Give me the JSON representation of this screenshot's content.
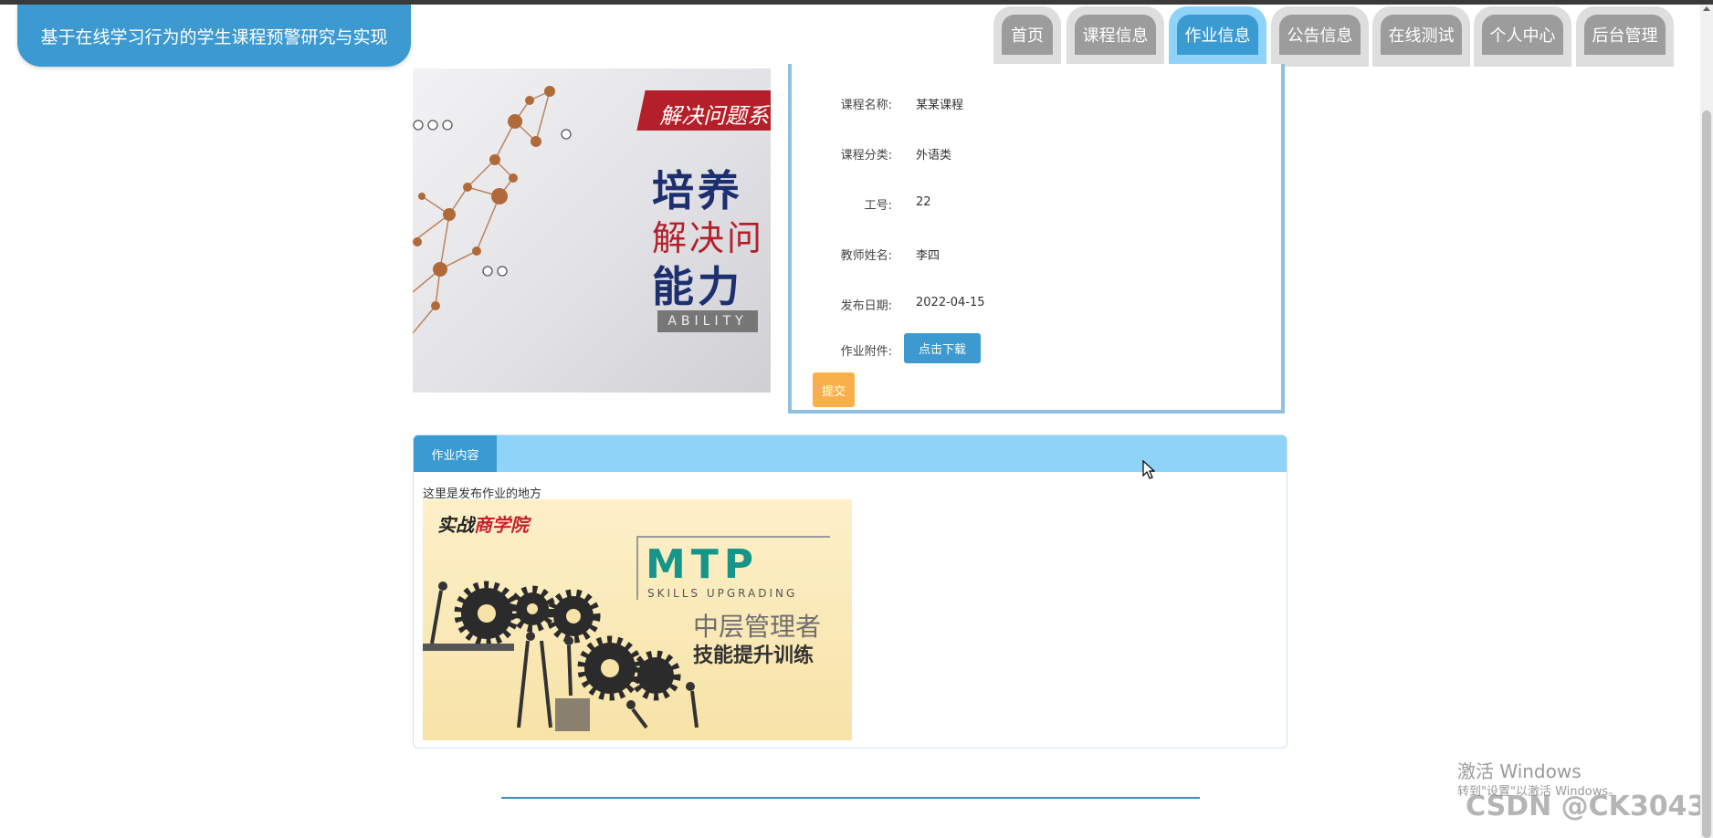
{
  "site": {
    "title": "基于在线学习行为的学生课程预警研究与实现"
  },
  "nav": {
    "items": [
      {
        "label": "首页",
        "active": false
      },
      {
        "label": "课程信息",
        "active": false
      },
      {
        "label": "作业信息",
        "active": true
      },
      {
        "label": "公告信息",
        "active": false
      },
      {
        "label": "在线测试",
        "active": false
      },
      {
        "label": "个人中心",
        "active": false
      },
      {
        "label": "后台管理",
        "active": false
      }
    ]
  },
  "banner": {
    "band_text": "解决问题系",
    "line1": "培养",
    "line2": "解决问",
    "line3": "能力",
    "tag": "ABILITY"
  },
  "detail": {
    "fields": [
      {
        "label": "课程名称:",
        "value": "某某课程"
      },
      {
        "label": "课程分类:",
        "value": "外语类"
      },
      {
        "label": "工号:",
        "value": "22"
      },
      {
        "label": "教师姓名:",
        "value": "李四"
      },
      {
        "label": "发布日期:",
        "value": "2022-04-15"
      }
    ],
    "attachment_label": "作业附件:",
    "download_button": "点击下载",
    "submit_button": "提交"
  },
  "content": {
    "tab": "作业内容",
    "description": "这里是发布作业的地方",
    "image": {
      "brand_prefix": "实战",
      "brand_main": "商学院",
      "logo": "MTP",
      "logo_sub": "SKILLS UPGRADING",
      "cn_line1": "中层管理者",
      "cn_line2": "技能提升训练"
    }
  },
  "watermark": {
    "activate_title": "激活 Windows",
    "activate_sub": "转到\"设置\"以激活 Windows。",
    "csdn": "CSDN @CK3043"
  },
  "colors": {
    "accent": "#3d9ad1",
    "tab_light": "#8fd3f8",
    "nav_inactive": "#9c9c9c",
    "submit": "#f9b04a"
  }
}
